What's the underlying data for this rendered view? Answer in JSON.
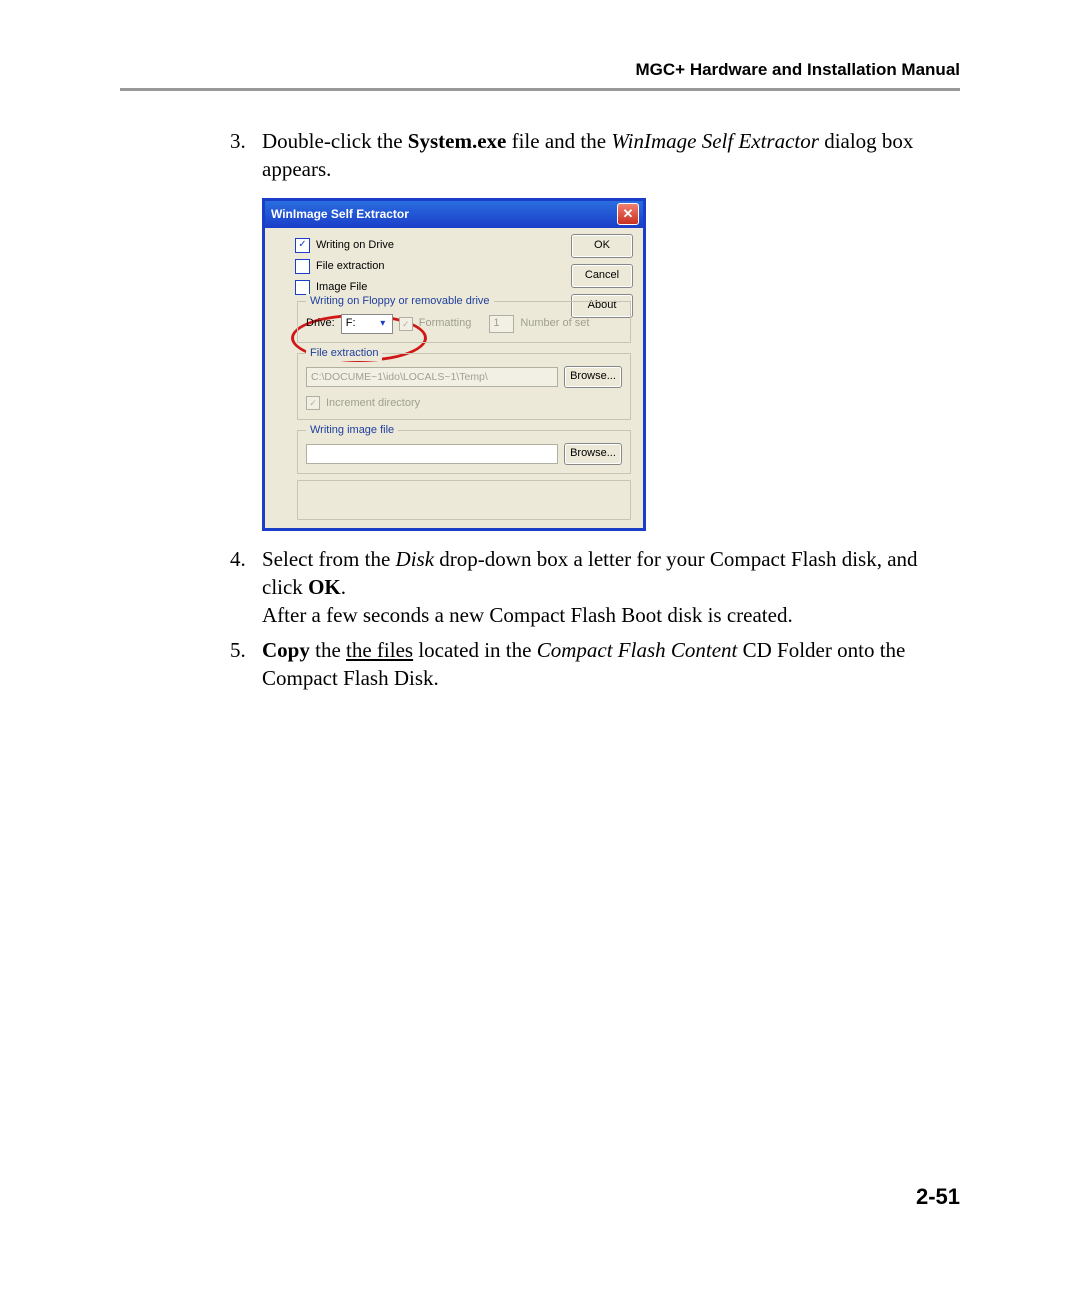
{
  "header": "MGC+ Hardware and Installation Manual",
  "page_number": "2-51",
  "step3": {
    "num": "3.",
    "pre": "Double-click the ",
    "bold1": "System.exe",
    "mid1": " file and the ",
    "ital1": "WinImage Self Extractor",
    "tail": " dialog box appears."
  },
  "step4": {
    "num": "4.",
    "pre": "Select from the ",
    "ital1": "Disk",
    "mid1": " drop-down box a letter for your Compact Flash disk, and click ",
    "bold1": "OK",
    "tail": ".",
    "line2": "After a few seconds a new Compact Flash Boot disk is created."
  },
  "step5": {
    "num": "5.",
    "bold1": "Copy",
    "mid1": " the ",
    "ul1": "the files",
    "mid2": " located in the ",
    "ital1": "Compact Flash Content",
    "tail": " CD Folder onto the Compact Flash Disk."
  },
  "dialog": {
    "title": "WinImage Self Extractor",
    "close": "✕",
    "cb_write_on_drive_checked": "✓",
    "cb_write_on_drive": "Writing on Drive",
    "cb_file_extraction": "File extraction",
    "cb_image_file": "Image File",
    "btn_ok": "OK",
    "btn_cancel": "Cancel",
    "btn_about": "About",
    "group1_legend": "Writing on Floppy or removable drive",
    "drive_label": "Drive:",
    "drive_value": "F:",
    "formatting_label": "Formatting",
    "numset_value": "1",
    "numset_label": "Number of set",
    "group2_legend": "File extraction",
    "path_value": "C:\\DOCUME~1\\ido\\LOCALS~1\\Temp\\",
    "browse": "Browse...",
    "increment_label": "Increment directory",
    "group3_legend": "Writing image file"
  }
}
